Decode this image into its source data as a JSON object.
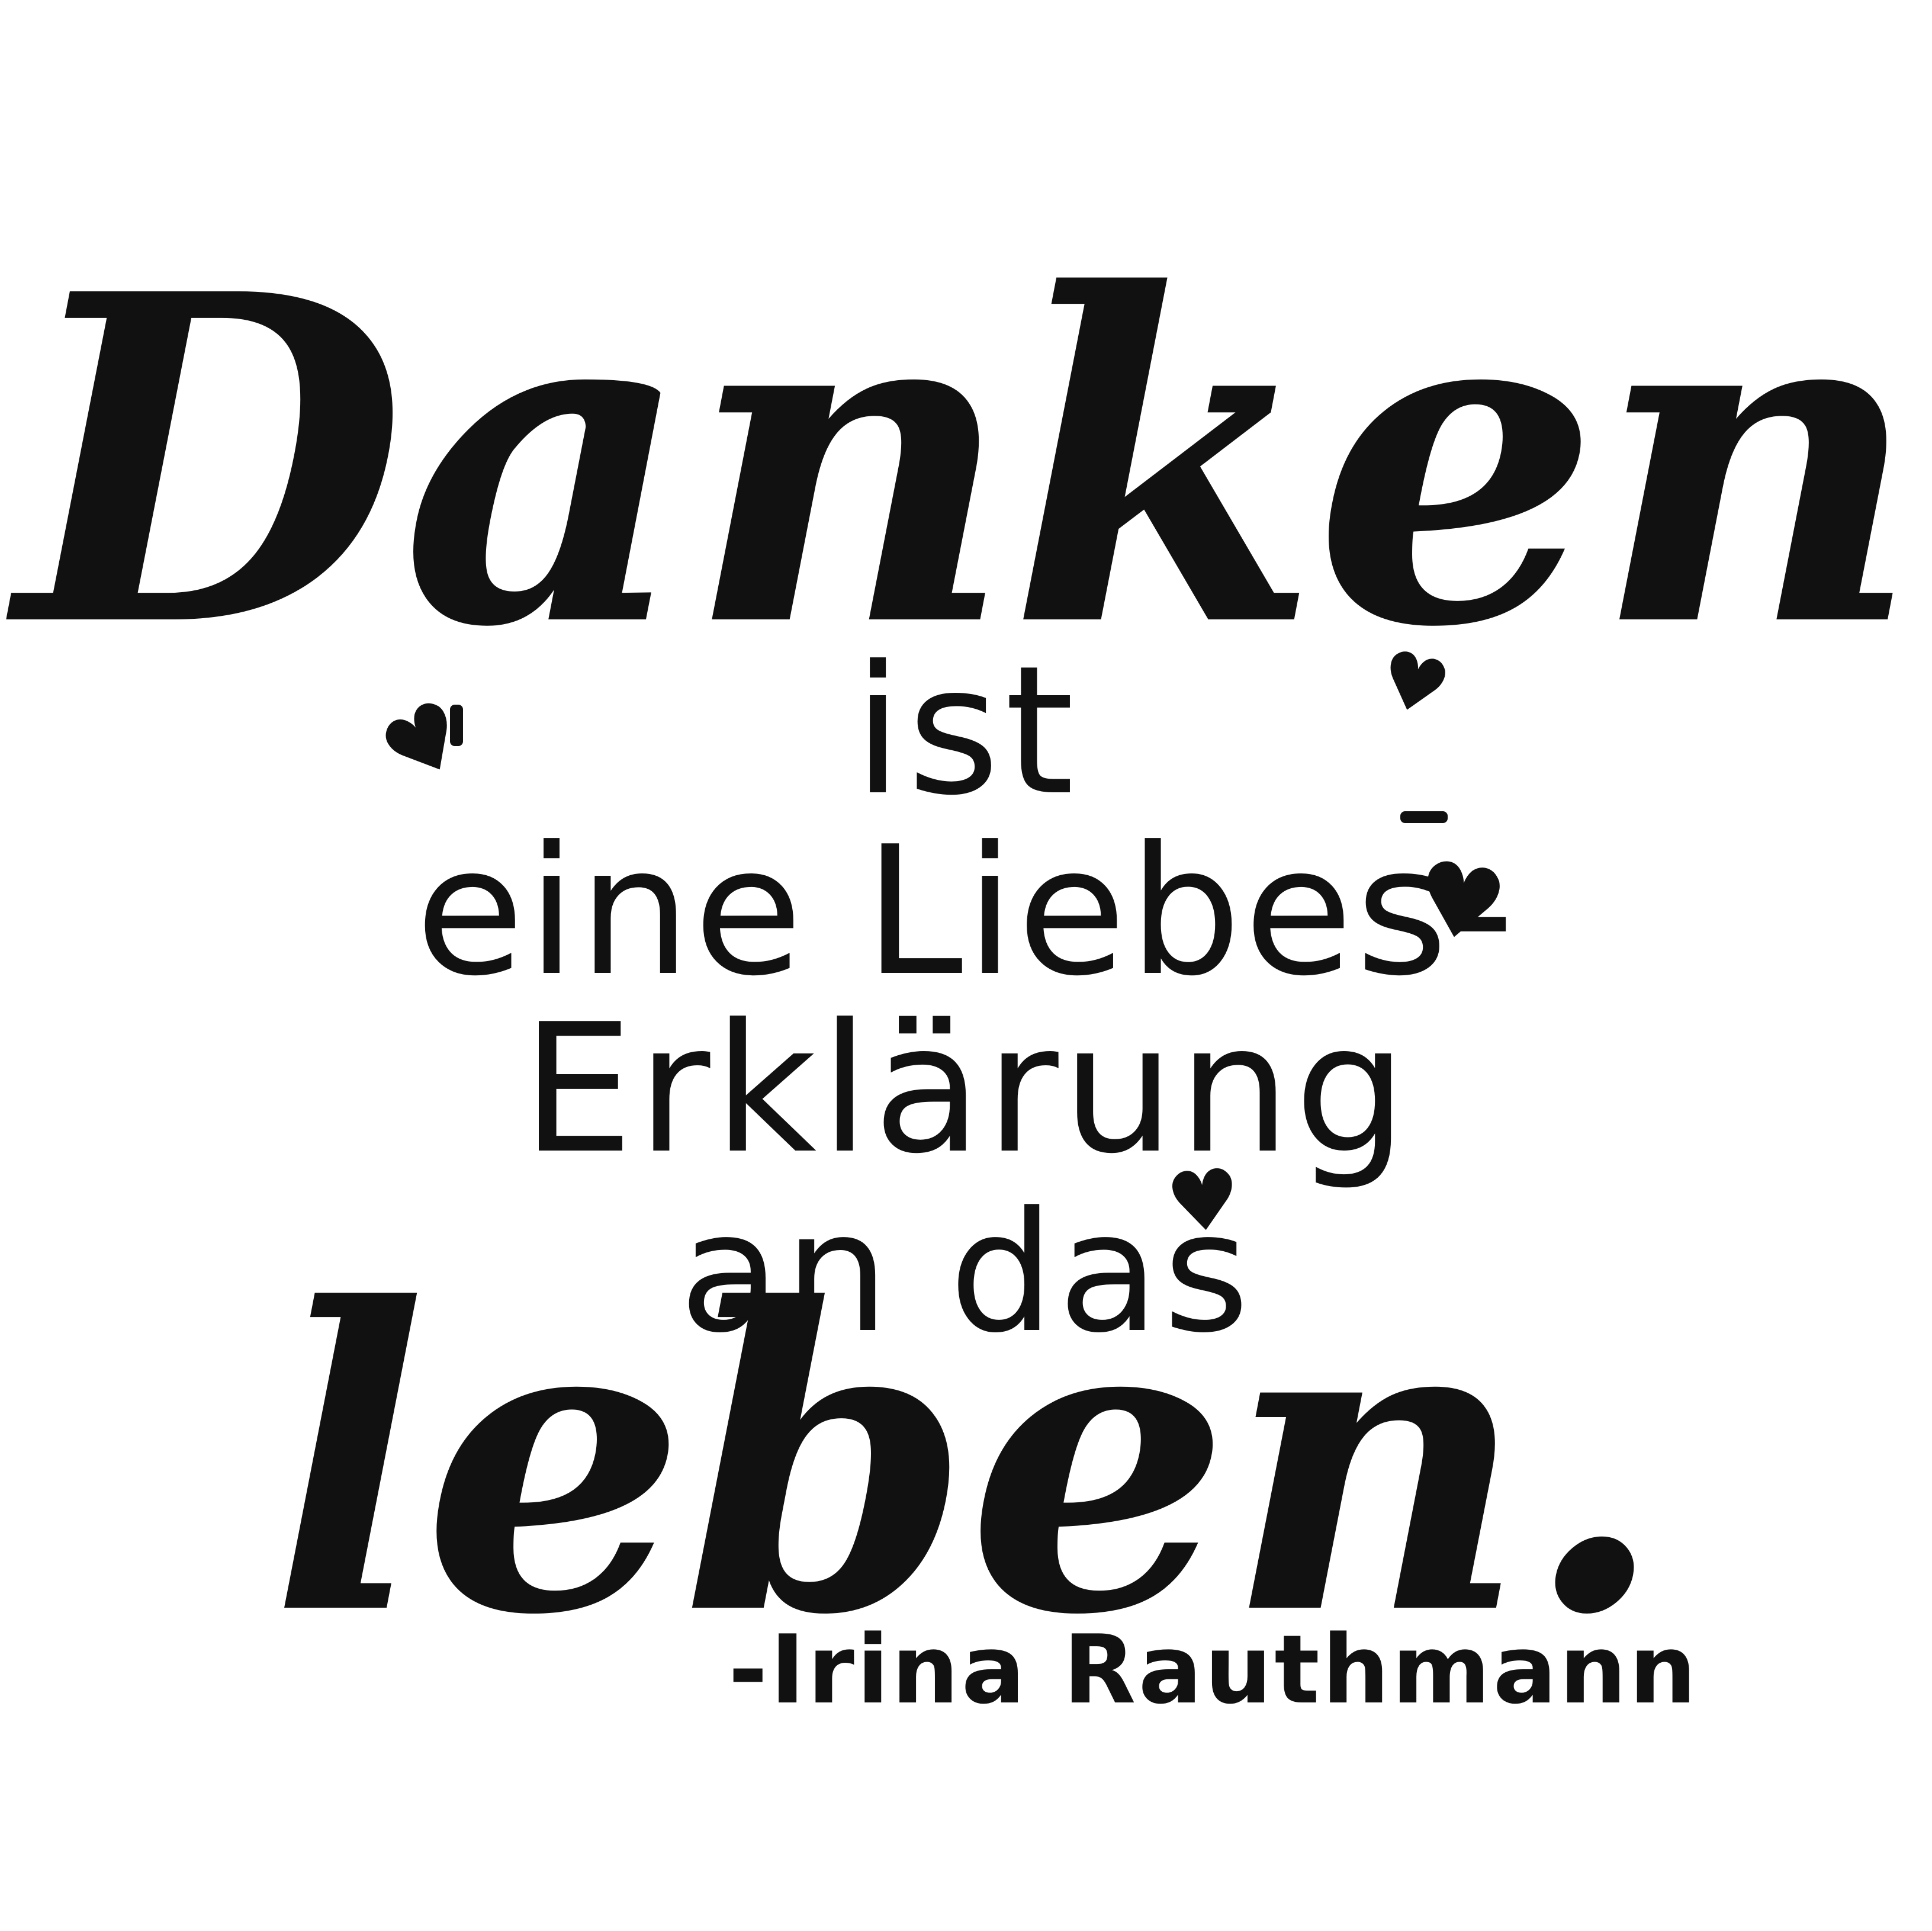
{
  "quote": {
    "line1": "Danken",
    "line2": "ist",
    "line3": "eine Liebes-",
    "line4": "Erklärung",
    "line5": "an das",
    "line6": "leben."
  },
  "author": "-Irina Rauthmann",
  "decorations": {
    "heart_icon": "heart-icon",
    "ink_color": "#111111",
    "background_color": "#ffffff"
  }
}
